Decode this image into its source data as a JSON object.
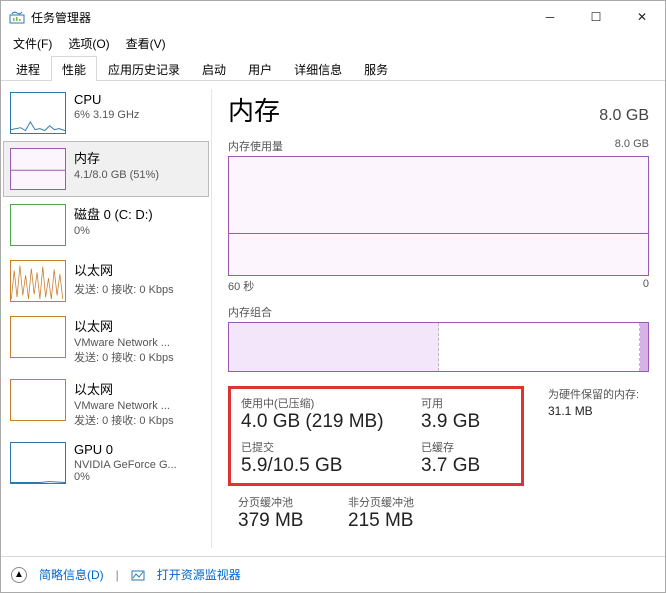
{
  "window": {
    "title": "任务管理器"
  },
  "menu": {
    "file": "文件(F)",
    "options": "选项(O)",
    "view": "查看(V)"
  },
  "tabs": {
    "processes": "进程",
    "performance": "性能",
    "history": "应用历史记录",
    "startup": "启动",
    "users": "用户",
    "details": "详细信息",
    "services": "服务"
  },
  "sidebar": {
    "cpu_name": "CPU",
    "cpu_sub": "6%  3.19 GHz",
    "mem_name": "内存",
    "mem_sub": "4.1/8.0 GB (51%)",
    "disk_name": "磁盘 0 (C: D:)",
    "disk_sub": "0%",
    "eth0_name": "以太网",
    "eth0_sub": "发送: 0 接收: 0 Kbps",
    "eth1_name": "以太网",
    "eth1_sub1": "VMware Network ...",
    "eth1_sub2": "发送: 0 接收: 0 Kbps",
    "eth2_name": "以太网",
    "eth2_sub1": "VMware Network ...",
    "eth2_sub2": "发送: 0 接收: 0 Kbps",
    "gpu_name": "GPU 0",
    "gpu_sub1": "NVIDIA GeForce G...",
    "gpu_sub2": "0%"
  },
  "detail": {
    "title": "内存",
    "total": "8.0 GB",
    "usage_label": "内存使用量",
    "usage_max": "8.0 GB",
    "time_left": "60 秒",
    "time_right": "0",
    "combo_label": "内存组合",
    "in_use_label": "使用中(已压缩)",
    "in_use_val": "4.0 GB (219 MB)",
    "avail_label": "可用",
    "avail_val": "3.9 GB",
    "commit_label": "已提交",
    "commit_val": "5.9/10.5 GB",
    "cached_label": "已缓存",
    "cached_val": "3.7 GB",
    "reserved_label": "为硬件保留的内存:",
    "reserved_val": "31.1 MB",
    "paged_label": "分页缓冲池",
    "paged_val": "379 MB",
    "nonpaged_label": "非分页缓冲池",
    "nonpaged_val": "215 MB"
  },
  "bottom": {
    "fewer": "简略信息(D)",
    "resmon": "打开资源监视器"
  }
}
